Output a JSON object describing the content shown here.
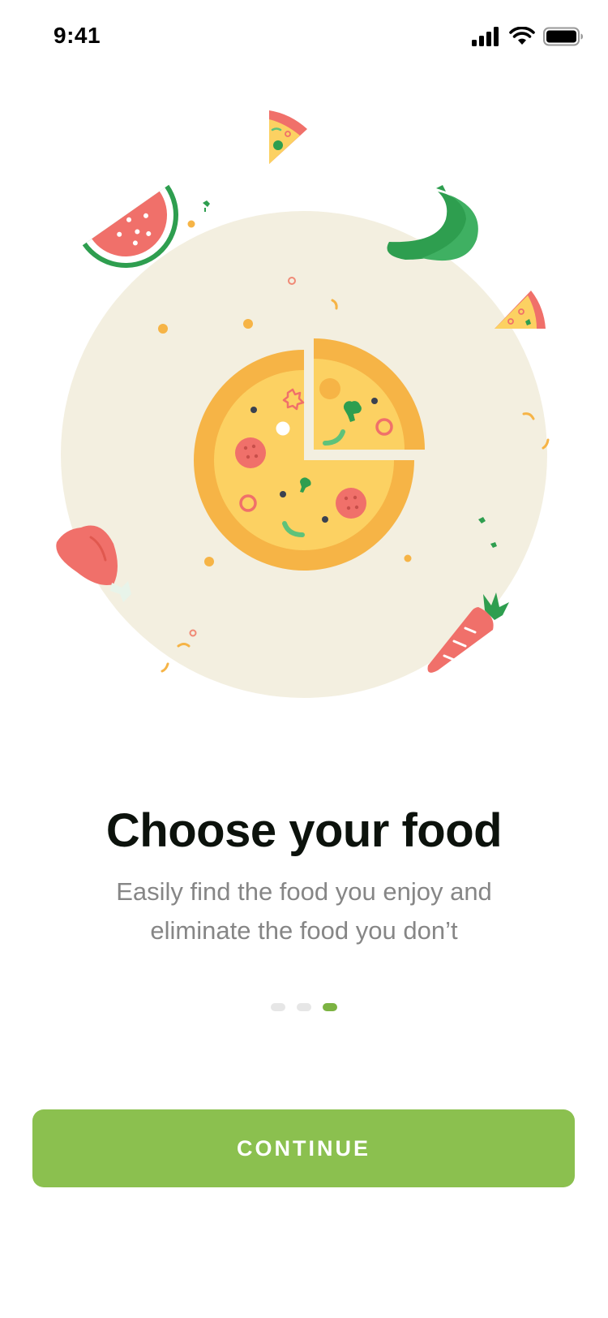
{
  "status_bar": {
    "time": "9:41",
    "icons": [
      "cellular-signal-icon",
      "wifi-icon",
      "battery-icon"
    ]
  },
  "illustration": {
    "icons": [
      "pizza-icon",
      "pizza-slice-icon",
      "watermelon-icon",
      "banana-icon",
      "drumstick-icon",
      "carrot-icon"
    ]
  },
  "onboarding": {
    "title": "Choose your food",
    "subtitle_line1": "Easily find the food you enjoy and",
    "subtitle_line2": "eliminate the food you don’t",
    "page_count": 3,
    "active_page": 3
  },
  "actions": {
    "continue_label": "CONTINUE"
  },
  "colors": {
    "accent": "#8bc04f",
    "active_dot": "#7cb342",
    "inactive_dot": "#e6e6e6",
    "title": "#0c120c",
    "subtitle": "#868686",
    "backdrop_circle": "#f3efe0"
  }
}
